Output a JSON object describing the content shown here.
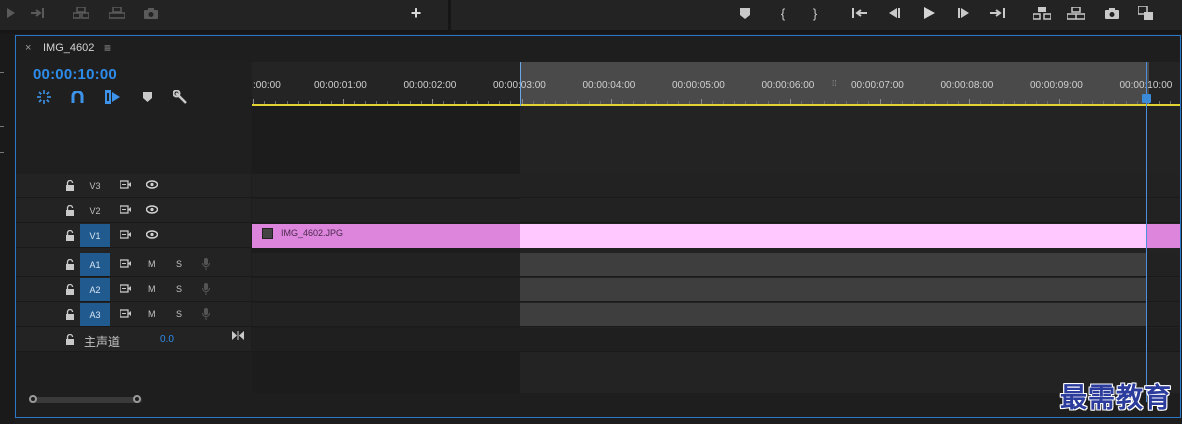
{
  "window": {
    "sequence_tab": "IMG_4602",
    "close_glyph": "×",
    "menu_glyph": "≡"
  },
  "timecode": "00:00:10:00",
  "toolbar_left": {
    "icons": [
      "play-icon",
      "go-to-out-icon",
      "insert-icon",
      "overwrite-icon",
      "export-frame-icon"
    ],
    "add_button": "+"
  },
  "toolbar_right": {
    "icons": [
      "add-marker-icon",
      "mark-in-icon",
      "mark-out-icon",
      "go-to-in-icon",
      "step-back-icon",
      "play-icon",
      "step-forward-icon",
      "go-to-out-icon",
      "lift-icon",
      "extract-icon",
      "export-frame-icon",
      "compare-view-icon"
    ]
  },
  "tools": [
    "nest-icon",
    "snap-icon",
    "linked-selection-icon",
    "add-marker-icon",
    "wrench-icon"
  ],
  "ruler": {
    "labels": [
      ":00:00",
      "00:00:01:00",
      "00:00:02:00",
      "00:00:03:00",
      "00:00:04:00",
      "00:00:05:00",
      "00:00:06:00",
      "00:00:07:00",
      "00:00:08:00",
      "00:00:09:00",
      "00:00:10:00"
    ]
  },
  "tracks": {
    "video": [
      {
        "name": "V3",
        "selected": false
      },
      {
        "name": "V2",
        "selected": false
      },
      {
        "name": "V1",
        "selected": true
      }
    ],
    "audio": [
      {
        "name": "A1",
        "selected": true,
        "mute": "M",
        "solo": "S"
      },
      {
        "name": "A2",
        "selected": true,
        "mute": "M",
        "solo": "S"
      },
      {
        "name": "A3",
        "selected": true,
        "mute": "M",
        "solo": "S"
      }
    ],
    "master": {
      "label": "主声道",
      "value": "0.0"
    }
  },
  "clip": {
    "name": "IMG_4602.JPG",
    "color_dark": "#dd84dd",
    "color_light": "#ffc8ff"
  },
  "colors": {
    "accent": "#2d8ceb",
    "panel_border": "#2b78c9",
    "ruler_line": "#e3d233"
  },
  "watermark": "最需教育"
}
